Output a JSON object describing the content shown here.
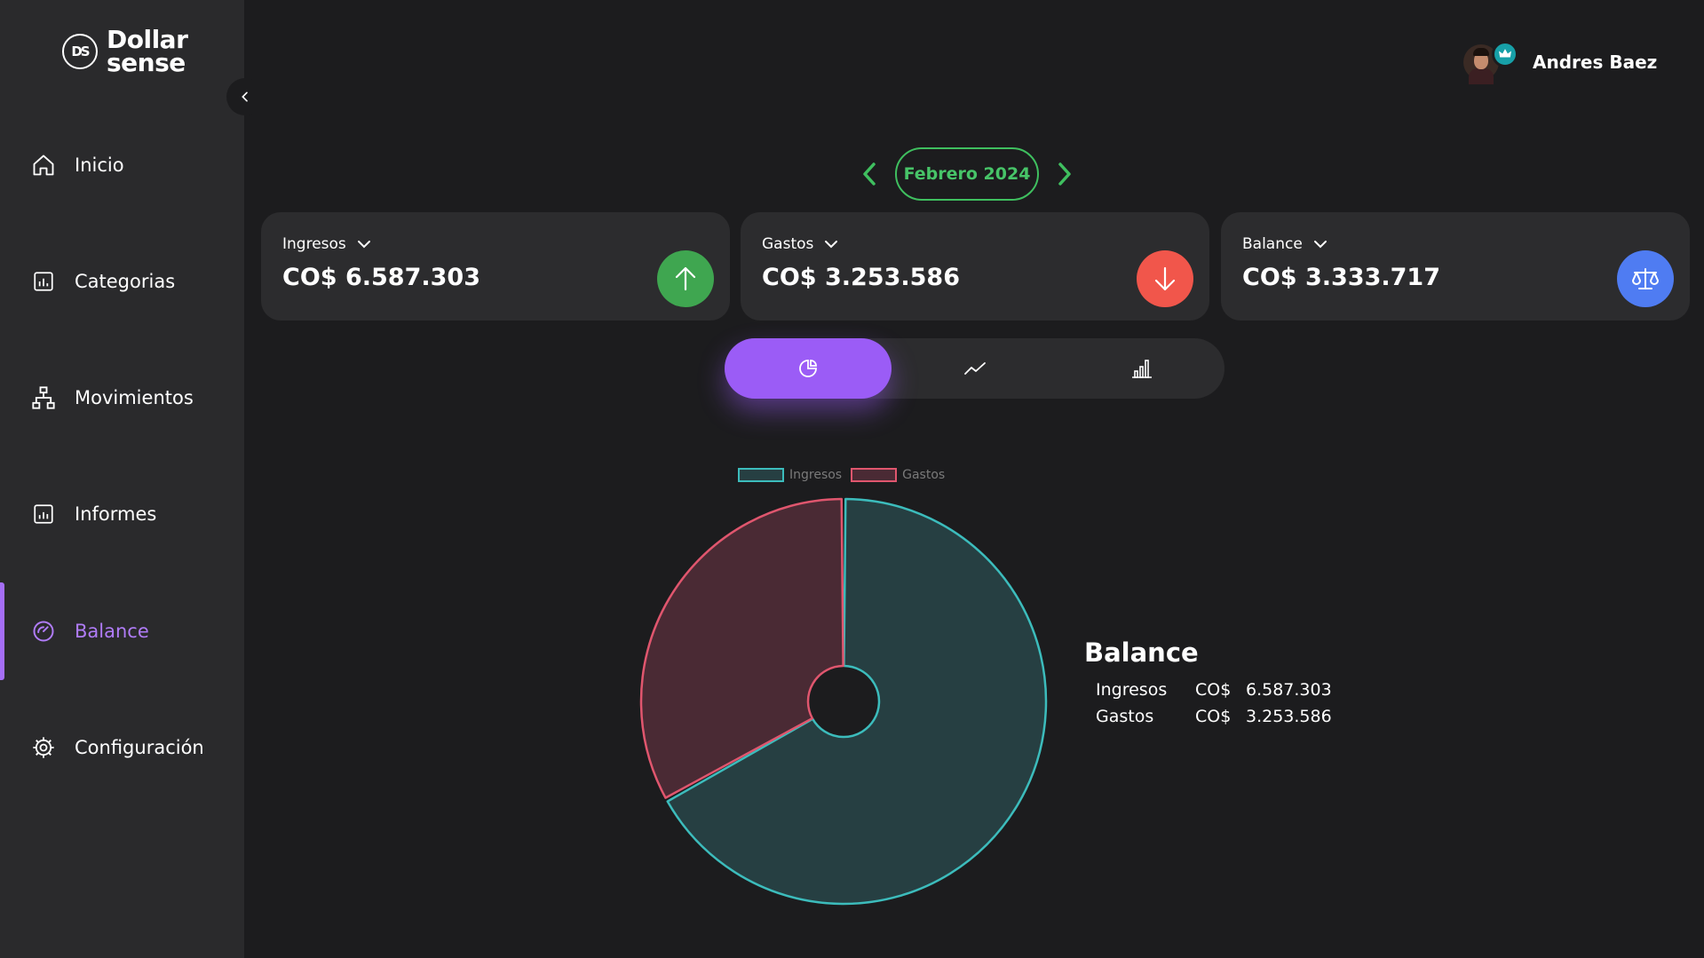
{
  "app": {
    "logo_line1": "Dollar",
    "logo_line2": "sense",
    "logo_mark": "DS"
  },
  "sidebar": {
    "items": [
      {
        "label": "Inicio",
        "icon": "home-icon"
      },
      {
        "label": "Categorias",
        "icon": "chart-box-icon"
      },
      {
        "label": "Movimientos",
        "icon": "hierarchy-icon"
      },
      {
        "label": "Informes",
        "icon": "report-icon"
      },
      {
        "label": "Balance",
        "icon": "gauge-icon",
        "active": true
      },
      {
        "label": "Configuración",
        "icon": "gear-icon"
      }
    ]
  },
  "user": {
    "name": "Andres Baez",
    "badge_icon": "crown-icon"
  },
  "month": {
    "label": "Febrero 2024"
  },
  "cards": [
    {
      "label": "Ingresos",
      "value": "CO$ 6.587.303",
      "icon": "arrow-up-icon",
      "color": "#3fa650"
    },
    {
      "label": "Gastos",
      "value": "CO$ 3.253.586",
      "icon": "arrow-down-icon",
      "color": "#f1564b"
    },
    {
      "label": "Balance",
      "value": "CO$ 3.333.717",
      "icon": "scale-icon",
      "color": "#4f7cf2"
    }
  ],
  "chart_toggle": {
    "options": [
      "pie-chart-icon",
      "line-chart-icon",
      "bar-chart-icon"
    ],
    "active": 0
  },
  "chart_data": {
    "type": "pie",
    "categories": [
      "Ingresos",
      "Gastos"
    ],
    "values": [
      6587303,
      3253586
    ],
    "colors": {
      "Ingresos": "#3cbcbc",
      "Gastos": "#e0566e"
    },
    "legend_position": "top"
  },
  "balance_summary": {
    "title": "Balance",
    "rows": [
      {
        "label": "Ingresos",
        "currency": "CO$",
        "amount": "6.587.303"
      },
      {
        "label": "Gastos",
        "currency": "CO$",
        "amount": "3.253.586"
      }
    ]
  }
}
